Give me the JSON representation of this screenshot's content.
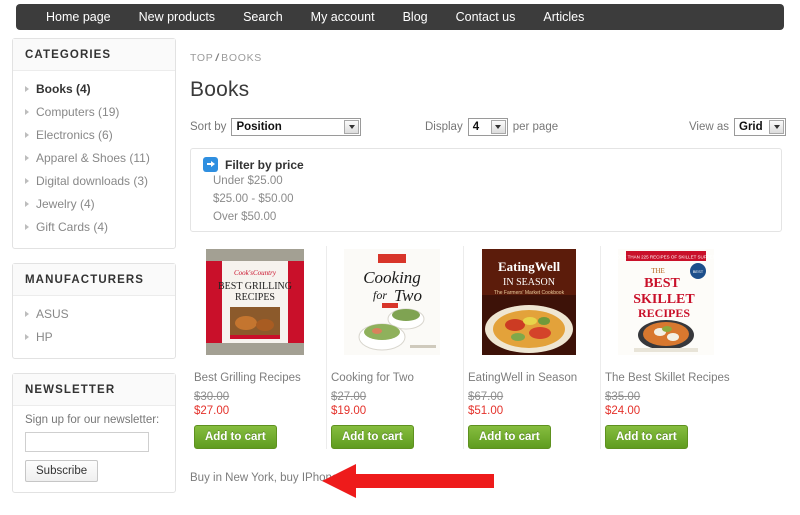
{
  "nav": {
    "items": [
      {
        "label": "Home page"
      },
      {
        "label": "New products"
      },
      {
        "label": "Search"
      },
      {
        "label": "My account"
      },
      {
        "label": "Blog"
      },
      {
        "label": "Contact us"
      },
      {
        "label": "Articles"
      }
    ]
  },
  "sidebar": {
    "categories": {
      "title": "CATEGORIES",
      "items": [
        {
          "label": "Books (4)",
          "active": true
        },
        {
          "label": "Computers (19)",
          "active": false
        },
        {
          "label": "Electronics (6)",
          "active": false
        },
        {
          "label": "Apparel & Shoes (11)",
          "active": false
        },
        {
          "label": "Digital downloads (3)",
          "active": false
        },
        {
          "label": "Jewelry (4)",
          "active": false
        },
        {
          "label": "Gift Cards (4)",
          "active": false
        }
      ]
    },
    "manufacturers": {
      "title": "MANUFACTURERS",
      "items": [
        {
          "label": "ASUS"
        },
        {
          "label": "HP"
        }
      ]
    },
    "newsletter": {
      "title": "NEWSLETTER",
      "label": "Sign up for our newsletter:",
      "input_value": "",
      "input_placeholder": "",
      "button_label": "Subscribe"
    }
  },
  "main": {
    "breadcrumb": {
      "root": "TOP",
      "separator": "/",
      "current": "BOOKS"
    },
    "page_title": "Books",
    "options": {
      "sort_label": "Sort by",
      "sort_value": "Position",
      "display_label": "Display",
      "display_value": "4",
      "per_page_label": "per page",
      "view_label": "View as",
      "view_value": "Grid"
    },
    "filter": {
      "title": "Filter by price",
      "icon": "arrow-right-icon",
      "options": [
        {
          "label": "Under $25.00"
        },
        {
          "label": "$25.00 - $50.00"
        },
        {
          "label": "Over $50.00"
        }
      ]
    },
    "products": [
      {
        "title": "Best Grilling Recipes",
        "old_price": "$30.00",
        "new_price": "$27.00",
        "cart_label": "Add to cart",
        "cover_text": "BEST GRILLING RECIPES"
      },
      {
        "title": "Cooking for Two",
        "old_price": "$27.00",
        "new_price": "$19.00",
        "cart_label": "Add to cart",
        "cover_text": "Cooking for Two"
      },
      {
        "title": "EatingWell in Season",
        "old_price": "$67.00",
        "new_price": "$51.00",
        "cart_label": "Add to cart",
        "cover_text": "EatingWell IN SEASON"
      },
      {
        "title": "The Best Skillet Recipes",
        "old_price": "$35.00",
        "new_price": "$24.00",
        "cart_label": "Add to cart",
        "cover_text": "THE BEST SKILLET RECIPES"
      }
    ],
    "footnote": "Buy in New York, buy IPhone"
  },
  "annotation": {
    "arrow_color": "#ee1b1b",
    "arrow_direction": "left"
  },
  "colors": {
    "nav_bg": "#3c3c3c",
    "accent_blue": "#2f8fe0",
    "price_red": "#e4322b",
    "cart_green": "#6ca522"
  }
}
